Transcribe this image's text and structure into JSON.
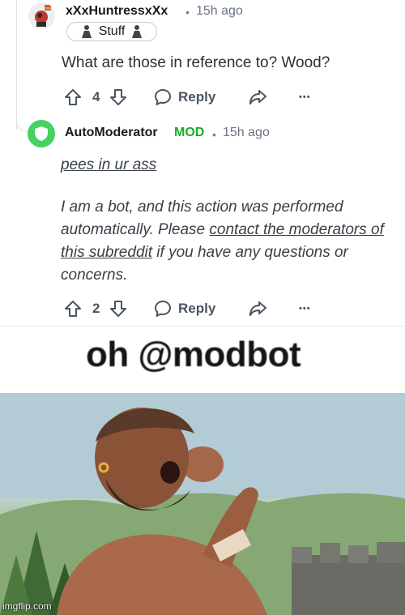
{
  "comment1": {
    "author": "xXxHuntressxXx",
    "separator": "•",
    "time": "15h ago",
    "flair": "Stuff",
    "body": "What are those in reference to? Wood?",
    "votes": "4",
    "reply_label": "Reply",
    "more": "•••"
  },
  "comment2": {
    "author": "AutoModerator",
    "mod_badge": "MOD",
    "separator": "•",
    "time": "15h ago",
    "line1": "pees in ur ass",
    "body_part1": "I am a bot, and this action was performed automatically. Please ",
    "body_link": "contact the moderators of this subreddit",
    "body_part2": " if you have any questions or concerns.",
    "votes": "2",
    "reply_label": "Reply",
    "more": "•••"
  },
  "meme": {
    "caption": "oh @modbot",
    "watermark": "imgflip.com"
  }
}
